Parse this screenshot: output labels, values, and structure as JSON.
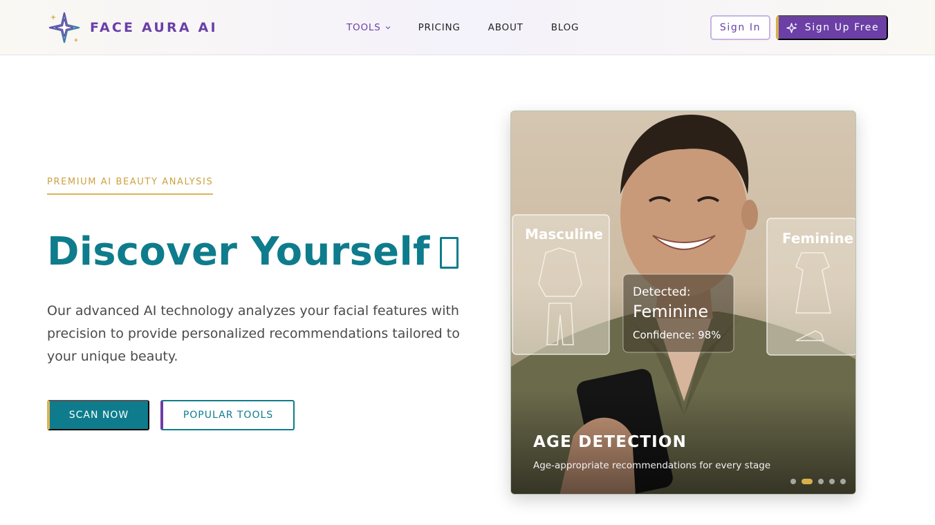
{
  "brand": {
    "name": "FACE AURA AI"
  },
  "nav": {
    "items": [
      {
        "label": "TOOLS",
        "active": true,
        "has_dropdown": true
      },
      {
        "label": "PRICING",
        "active": false
      },
      {
        "label": "ABOUT",
        "active": false
      },
      {
        "label": "BLOG",
        "active": false
      }
    ]
  },
  "auth": {
    "signin_label": "Sign In",
    "signup_label": "Sign Up Free"
  },
  "hero": {
    "eyebrow": "PREMIUM AI BEAUTY ANALYSIS",
    "headline": "Discover Yourself",
    "description": "Our advanced AI technology analyzes your facial features with precision to provide personalized recommendations tailored to your unique beauty.",
    "primary_cta": "SCAN NOW",
    "secondary_cta": "POPULAR TOOLS"
  },
  "carousel": {
    "image_labels": {
      "left_card": "Masculine",
      "right_card": "Feminine",
      "detected_label": "Detected:",
      "detected_value": "Feminine",
      "confidence": "Confidence: 98%"
    },
    "slide_title": "AGE DETECTION",
    "slide_subtitle": "Age-appropriate recommendations for every stage",
    "slide_count": 5,
    "active_index": 1
  },
  "colors": {
    "brand_purple": "#6b3fa6",
    "teal": "#0e7c8c",
    "gold": "#d9b45a"
  },
  "icons": [
    "sparkle-star-logo-icon",
    "chevron-down-icon",
    "sparkles-icon"
  ]
}
